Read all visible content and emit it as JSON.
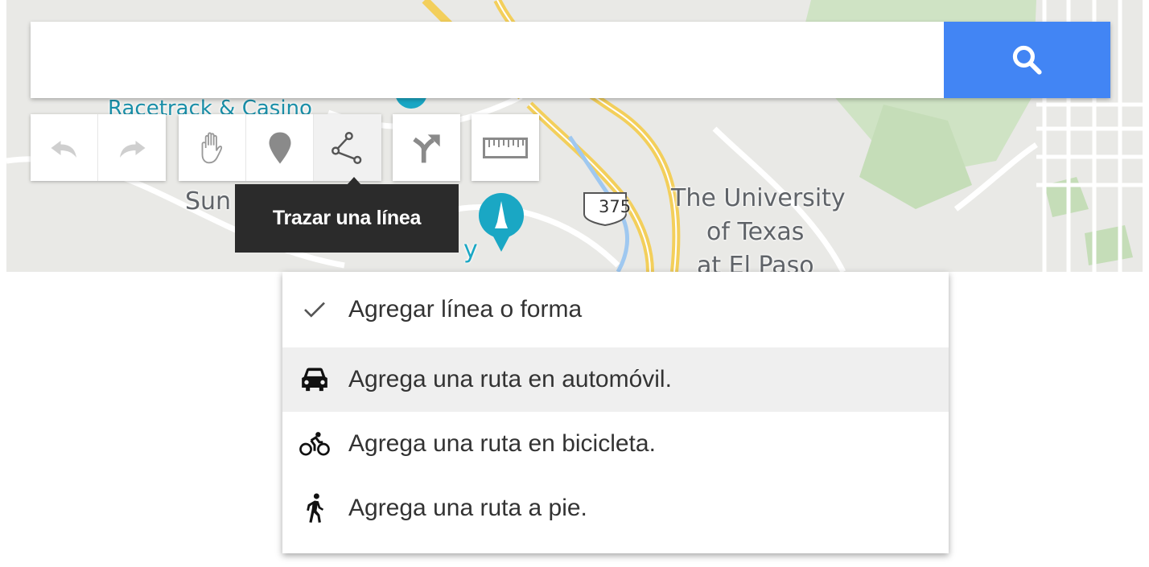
{
  "map": {
    "labels": {
      "university_line1": "The University",
      "university_line2": "of Texas",
      "university_line3": "at El Paso",
      "highway": "375",
      "partial_sun": "Sun",
      "partial_y": "y",
      "partial_casino": "Racetrack & Casino"
    }
  },
  "search": {
    "value": "",
    "placeholder": "",
    "icon": "search-icon",
    "button_color": "#4285f4"
  },
  "toolbar": {
    "undo_icon": "undo-icon",
    "redo_icon": "redo-icon",
    "select_icon": "hand-icon",
    "marker_icon": "marker-icon",
    "draw_line_icon": "draw-line-icon",
    "directions_icon": "directions-icon",
    "measure_icon": "ruler-icon"
  },
  "tooltip": {
    "text": "Trazar una línea"
  },
  "menu": {
    "items": [
      {
        "label": "Agregar línea o forma",
        "icon": "check-icon",
        "selected": true
      },
      {
        "label": "Agrega una ruta en automóvil.",
        "icon": "car-icon",
        "hovered": true
      },
      {
        "label": "Agrega una ruta en bicicleta.",
        "icon": "bicycle-icon"
      },
      {
        "label": "Agrega una ruta a pie.",
        "icon": "walk-icon"
      }
    ]
  }
}
